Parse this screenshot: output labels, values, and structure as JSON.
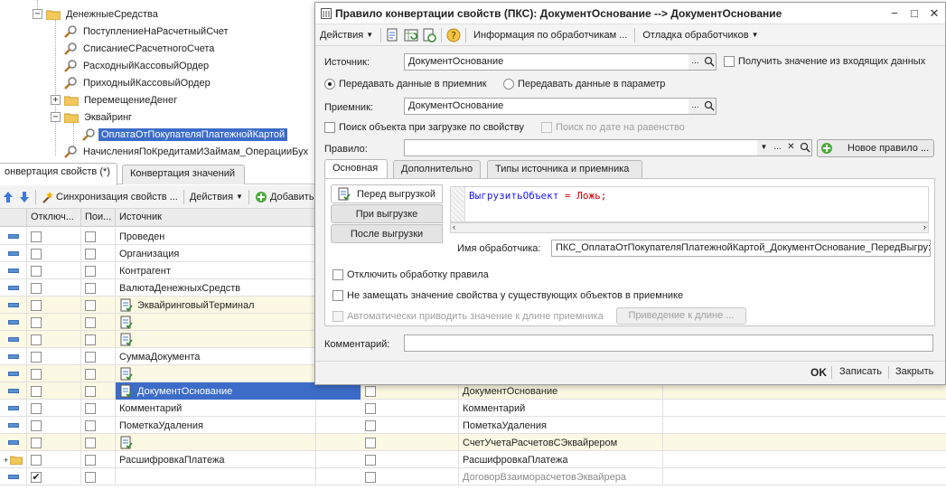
{
  "tree": {
    "root_label": "ДенежныеСредства",
    "items": [
      "ПоступлениеНаРасчетныйСчет",
      "СписаниеСРасчетногоСчета",
      "РасходныйКассовыйОрдер",
      "ПриходныйКассовыйОрдер"
    ],
    "moving_folder": "ПеремещениеДенег",
    "acquiring_folder": "Эквайринг",
    "selected_item": "ОплатаОтПокупателяПлатежнойКартой",
    "cut_item": "НачисленияПоКредитамИЗаймам_ОперацииБух"
  },
  "bottom_tabs": [
    "онвертация свойств (*)",
    "Конвертация значений"
  ],
  "toolbar2": {
    "sync_label": "Синхронизация свойств ...",
    "actions_label": "Действия",
    "add_label": "Добавить"
  },
  "grid": {
    "headers": [
      "Отключ...",
      "Пои...",
      "Источник"
    ],
    "rows": [
      {
        "source": "Проведен",
        "doc": false,
        "target": "",
        "yellow": false,
        "sel": false,
        "chk_off": false,
        "tcb": false,
        "target_gray": false,
        "folder": false
      },
      {
        "source": "Организация",
        "doc": false,
        "target": "",
        "yellow": false,
        "sel": false,
        "chk_off": false,
        "tcb": false,
        "target_gray": false,
        "folder": false
      },
      {
        "source": "Контрагент",
        "doc": false,
        "target": "",
        "yellow": false,
        "sel": false,
        "chk_off": false,
        "tcb": false,
        "target_gray": false,
        "folder": false
      },
      {
        "source": "ВалютаДенежныхСредств",
        "doc": false,
        "target": "",
        "yellow": false,
        "sel": false,
        "chk_off": false,
        "tcb": false,
        "target_gray": false,
        "folder": false
      },
      {
        "source": "ЭквайринговыйТерминал",
        "doc": true,
        "target": "",
        "yellow": true,
        "sel": false,
        "chk_off": false,
        "tcb": false,
        "target_gray": false,
        "folder": false
      },
      {
        "source": "",
        "doc": true,
        "target": "",
        "yellow": true,
        "sel": false,
        "chk_off": false,
        "tcb": false,
        "target_gray": false,
        "folder": false
      },
      {
        "source": "",
        "doc": true,
        "target": "",
        "yellow": true,
        "sel": false,
        "chk_off": false,
        "tcb": false,
        "target_gray": false,
        "folder": false
      },
      {
        "source": "СуммаДокумента",
        "doc": false,
        "target": "",
        "yellow": false,
        "sel": false,
        "chk_off": false,
        "tcb": false,
        "target_gray": false,
        "folder": false
      },
      {
        "source": "",
        "doc": true,
        "target": "",
        "yellow": true,
        "sel": false,
        "chk_off": false,
        "tcb": false,
        "target_gray": false,
        "folder": false
      },
      {
        "source": "ДокументОснование",
        "doc": true,
        "target": "ДокументОснование",
        "yellow": true,
        "sel": true,
        "chk_off": false,
        "tcb": true,
        "target_gray": false,
        "folder": false
      },
      {
        "source": "Комментарий",
        "doc": false,
        "target": "Комментарий",
        "yellow": false,
        "sel": false,
        "chk_off": false,
        "tcb": true,
        "target_gray": false,
        "folder": false
      },
      {
        "source": "ПометкаУдаления",
        "doc": false,
        "target": "ПометкаУдаления",
        "yellow": false,
        "sel": false,
        "chk_off": false,
        "tcb": true,
        "target_gray": false,
        "folder": false
      },
      {
        "source": "",
        "doc": true,
        "target": "СчетУчетаРасчетовСЭквайрером",
        "yellow": true,
        "sel": false,
        "chk_off": false,
        "tcb": true,
        "target_gray": false,
        "folder": false
      },
      {
        "source": "РасшифровкаПлатежа",
        "doc": false,
        "target": "РасшифровкаПлатежа",
        "yellow": false,
        "sel": false,
        "chk_off": false,
        "tcb": true,
        "target_gray": false,
        "folder": true
      },
      {
        "source": "",
        "doc": false,
        "target": "ДоговорВзаиморасчетовЭквайрера",
        "yellow": false,
        "sel": false,
        "chk_off": true,
        "tcb": true,
        "target_gray": true,
        "folder": false
      }
    ]
  },
  "dialog": {
    "title": "Правило конвертации свойств (ПКС): ДокументОснование --> ДокументОснование",
    "menu": {
      "actions": "Действия",
      "handlers_info": "Информация по обработчикам ...",
      "debug": "Отладка обработчиков"
    },
    "source_label": "Источник:",
    "source_value": "ДокументОснование",
    "get_incoming_label": "Получить значение из входящих данных",
    "radio_receiver": "Передавать данные в приемник",
    "radio_param": "Передавать данные в параметр",
    "receiver_label": "Приемник:",
    "receiver_value": "ДокументОснование",
    "search_by_property": "Поиск объекта при загрузке по свойству",
    "search_by_date": "Поиск по дате на равенство",
    "rule_label": "Правило:",
    "rule_value": "",
    "new_rule": "Новое правило ...",
    "tabs": [
      "Основная",
      "Дополнительно",
      "Типы источника и приемника"
    ],
    "events": [
      "Перед выгрузкой",
      "При выгрузке",
      "После выгрузки"
    ],
    "code": {
      "kw": "ВыгрузитьОбъект",
      "op": "= Ложь;"
    },
    "handler_name_label": "Имя обработчика:",
    "handler_name_value": "ПКС_ОплатаОтПокупателяПлатежнойКартой_ДокументОснование_ПередВыгру:",
    "disable_rule": "Отключить обработку правила",
    "no_replace": "Не замещать значение свойства у существующих объектов в приемнике",
    "auto_length": "Автоматически приводить значение к длине приемника",
    "length_btn": "Приведение к длине ...",
    "comment_label": "Комментарий:",
    "comment_value": "",
    "ok": "OK",
    "save": "Записать",
    "close": "Закрыть"
  },
  "colors": {
    "selection": "#3c6cc8",
    "yellow_row": "#fbf8e3",
    "code_keyword": "#1a1aff",
    "code_literal": "#cc0000"
  }
}
